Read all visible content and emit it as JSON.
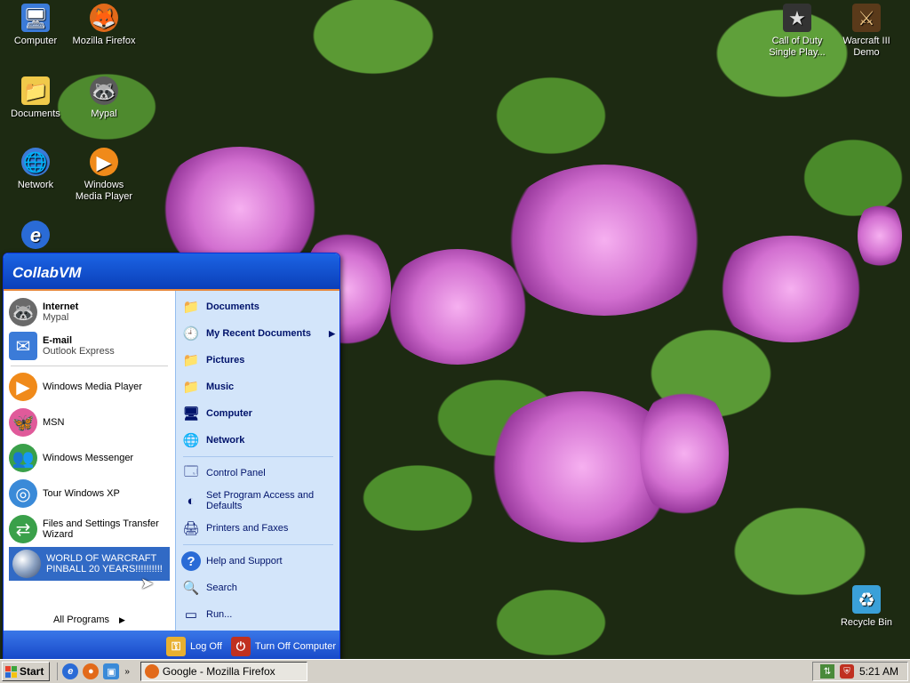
{
  "desktop": {
    "icons": [
      {
        "label": "Computer",
        "glyph": "🖥",
        "bg": "#3b7bd8"
      },
      {
        "label": "Mozilla Firefox",
        "glyph": "🦊",
        "bg": "#e26a1a"
      },
      {
        "label": "Documents",
        "glyph": "📁",
        "bg": "#f0c94a"
      },
      {
        "label": "Mypal",
        "glyph": "🦝",
        "bg": "#5a5a5a"
      },
      {
        "label": "Network",
        "glyph": "🌐",
        "bg": "#3b7bd8"
      },
      {
        "label": "Windows Media Player",
        "glyph": "▶",
        "bg": "#f08a1a"
      },
      {
        "label": "e",
        "glyph": "e",
        "bg": "#2a6bd6"
      },
      {
        "label": "Call of Duty Single Play...",
        "glyph": "★",
        "bg": "#333333"
      },
      {
        "label": "Warcraft III Demo",
        "glyph": "⚔",
        "bg": "#5a3a1a"
      },
      {
        "label": "Recycle Bin",
        "glyph": "♻",
        "bg": "#3aa0d8"
      }
    ]
  },
  "startmenu": {
    "user": "CollabVM",
    "pinned": [
      {
        "title": "Internet",
        "sub": "Mypal",
        "glyph": "🦝",
        "bg": "#6a6a6a"
      },
      {
        "title": "E-mail",
        "sub": "Outlook Express",
        "glyph": "✉",
        "bg": "#3b7bd8"
      }
    ],
    "recent": [
      {
        "label": "Windows Media Player",
        "glyph": "▶",
        "bg": "#f08a1a"
      },
      {
        "label": "MSN",
        "glyph": "🦋",
        "bg": "#e05a9a"
      },
      {
        "label": "Windows Messenger",
        "glyph": "👥",
        "bg": "#3aa04a"
      },
      {
        "label": "Tour Windows XP",
        "glyph": "◎",
        "bg": "#3a8ad8"
      },
      {
        "label": "Files and Settings Transfer Wizard",
        "glyph": "⇄",
        "bg": "#3aa04a"
      },
      {
        "label": "WORLD OF WARCRAFT PINBALL 20 YEARS!!!!!!!!!!",
        "glyph": "●",
        "bg": "#8aa0c0"
      }
    ],
    "all_programs": "All Programs",
    "right": [
      {
        "label": "Documents",
        "glyph": "📁",
        "bold": true
      },
      {
        "label": "My Recent Documents",
        "glyph": "🕘",
        "bold": true,
        "arrow": "▶"
      },
      {
        "label": "Pictures",
        "glyph": "📁",
        "bold": true
      },
      {
        "label": "Music",
        "glyph": "📁",
        "bold": true
      },
      {
        "label": "Computer",
        "glyph": "🖥",
        "bold": true
      },
      {
        "label": "Network",
        "glyph": "🌐",
        "bold": true
      },
      {
        "label": "Control Panel",
        "glyph": "🗔",
        "bold": false
      },
      {
        "label": "Set Program Access and Defaults",
        "glyph": "◐",
        "bold": false
      },
      {
        "label": "Printers and Faxes",
        "glyph": "🖨",
        "bold": false
      },
      {
        "label": "Help and Support",
        "glyph": "?",
        "bold": false
      },
      {
        "label": "Search",
        "glyph": "🔍",
        "bold": false
      },
      {
        "label": "Run...",
        "glyph": "▭",
        "bold": false
      }
    ],
    "logoff": "Log Off",
    "turnoff": "Turn Off Computer"
  },
  "taskbar": {
    "start": "Start",
    "task": "Google - Mozilla Firefox",
    "clock": "5:21 AM"
  }
}
